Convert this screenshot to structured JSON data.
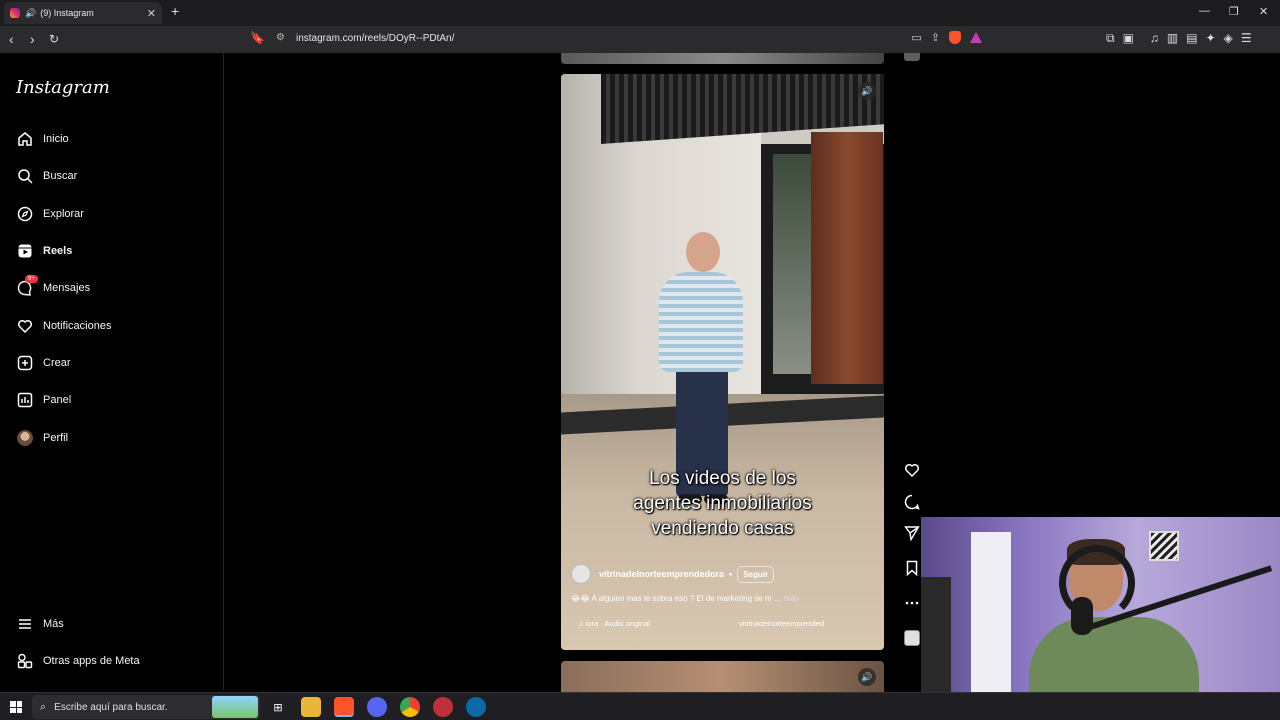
{
  "browser": {
    "tab_title": "(9) Instagram",
    "tab_close": "✕",
    "new_tab": "+",
    "url": "instagram.com/reels/DOyR--PDtAn/",
    "window_controls": [
      "—",
      "❐",
      "✕"
    ]
  },
  "sidebar": {
    "logo": "Instagram",
    "items": [
      {
        "label": "Inicio",
        "icon": "home-icon"
      },
      {
        "label": "Buscar",
        "icon": "search-icon"
      },
      {
        "label": "Explorar",
        "icon": "compass-icon"
      },
      {
        "label": "Reels",
        "icon": "reels-icon"
      },
      {
        "label": "Mensajes",
        "icon": "messenger-icon",
        "badge": "9+"
      },
      {
        "label": "Notificaciones",
        "icon": "heart-icon"
      },
      {
        "label": "Crear",
        "icon": "plus-square-icon"
      },
      {
        "label": "Panel",
        "icon": "chart-icon"
      },
      {
        "label": "Perfil",
        "icon": "avatar"
      }
    ],
    "bottom": [
      {
        "label": "Más",
        "icon": "menu-icon"
      },
      {
        "label": "Otras apps de Meta",
        "icon": "meta-apps-icon"
      }
    ]
  },
  "reel": {
    "caption_lines": [
      "Los videos de los",
      "agentes inmobiliarios",
      "vendiendo casas"
    ],
    "username": "vitrinadelnorteemprendedora",
    "separator": "•",
    "follow_label": "Seguir",
    "description": "😂😂 A alguien mas le sobra eso ? El de marketing se m …",
    "more_label": "más",
    "audio": "♫ iora · Audio original",
    "audio_user": "vitrinadelnorteemprended"
  },
  "taskbar": {
    "search_placeholder": "Escribe aquí para buscar."
  },
  "colors": {
    "badge": "#ff3040",
    "background": "#000000",
    "chrome": "#2b2b2e"
  }
}
